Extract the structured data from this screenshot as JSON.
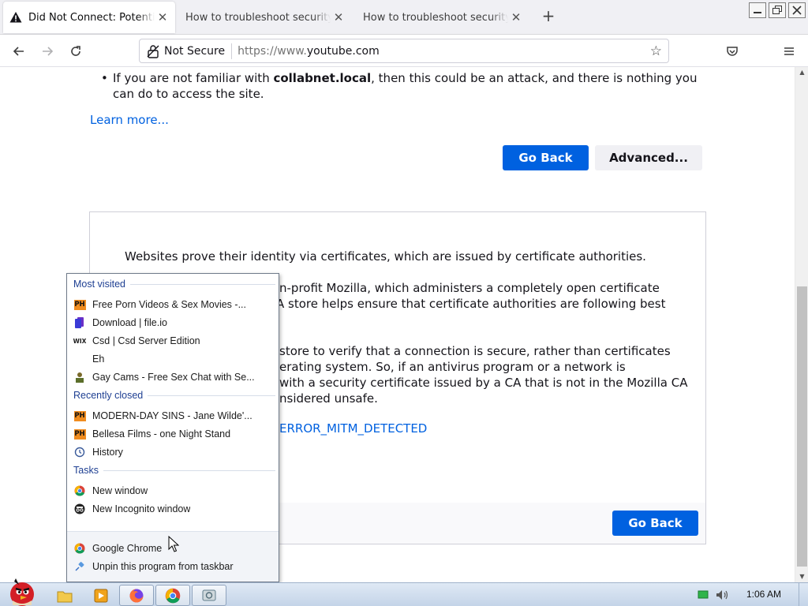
{
  "browser": {
    "tabs": [
      {
        "title": "Did Not Connect: Potential Se",
        "active": true,
        "icon": "warning-icon"
      },
      {
        "title": "How to troubleshoot security err",
        "active": false
      },
      {
        "title": "How to troubleshoot security err",
        "active": false
      }
    ],
    "new_tab_label": "+",
    "security_label": "Not Secure",
    "url_prefix": "https://www.",
    "url_host": "youtube.com"
  },
  "page": {
    "bullet_prefix": "If you are not familiar with ",
    "bullet_domain": "collabnet.local",
    "bullet_suffix": ", then this could be an attack, and there is nothing you can do to access the site.",
    "learn_more": "Learn more...",
    "go_back": "Go Back",
    "advanced": "Advanced...",
    "adv_p1": "Websites prove their identity via certificates, which are issued by certificate authorities.",
    "adv_p2a": "n-profit Mozilla, which administers a completely open certificate",
    "adv_p2b": "A store helps ensure that certificate authorities are following best",
    "adv_p3a": "store to verify that a connection is secure, rather than certificates",
    "adv_p3b": "erating system. So, if an antivirus program or a network is",
    "adv_p3c": "with a security certificate issued by a CA that is not in the Mozilla CA",
    "adv_p3d": "nsidered unsafe.",
    "error_code": "ERROR_MITM_DETECTED",
    "footer_go_back": "Go Back"
  },
  "jumplist": {
    "most_visited_header": "Most visited",
    "most_visited": [
      {
        "label": "Free Porn Videos & Sex Movies -...",
        "icon": "ph-icon"
      },
      {
        "label": "Download | file.io",
        "icon": "fileio-icon"
      },
      {
        "label": "Csd | Csd Server Edition",
        "icon": "wix-icon"
      },
      {
        "label": "Eh",
        "icon": "blank-icon"
      },
      {
        "label": "Gay Cams - Free Sex Chat with Se...",
        "icon": "cam-icon"
      }
    ],
    "recently_closed_header": "Recently closed",
    "recently_closed": [
      {
        "label": "MODERN-DAY SINS - Jane Wilde'...",
        "icon": "ph-icon"
      },
      {
        "label": "Bellesa Films - one Night Stand",
        "icon": "ph-icon"
      },
      {
        "label": "History",
        "icon": "history-icon"
      }
    ],
    "tasks_header": "Tasks",
    "tasks": [
      {
        "label": "New window",
        "icon": "chrome-icon"
      },
      {
        "label": "New Incognito window",
        "icon": "incognito-icon"
      }
    ],
    "app_label": "Google Chrome",
    "unpin_label": "Unpin this program from taskbar",
    "ph_text": "PH",
    "wix_text": "WIX"
  },
  "taskbar": {
    "clock": "1:06 AM"
  }
}
